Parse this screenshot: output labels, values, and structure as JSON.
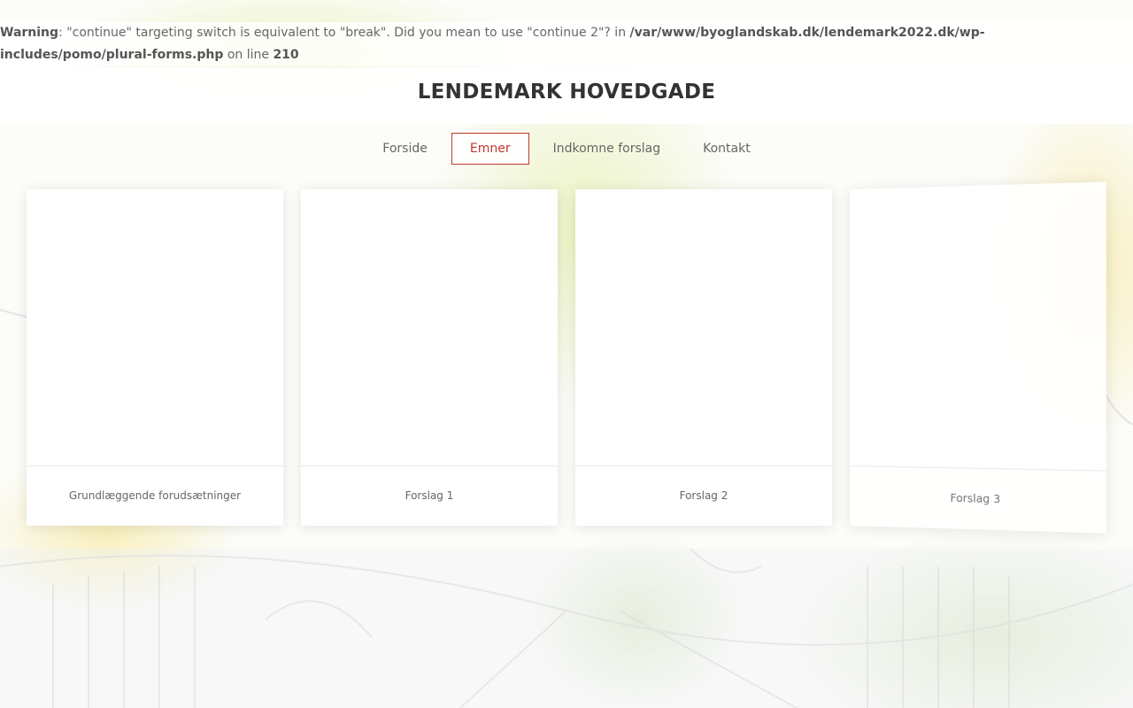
{
  "warning": {
    "label": "Warning",
    "message": ": \"continue\" targeting switch is equivalent to \"break\". Did you mean to use \"continue 2\"? in ",
    "path": "/var/www/byoglandskab.dk/lendemark2022.dk/wp-includes/pomo/plural-forms.php",
    "on_line": " on line ",
    "line": "210"
  },
  "header": {
    "title": "LENDEMARK HOVEDGADE"
  },
  "nav": {
    "items": [
      {
        "label": "Forside"
      },
      {
        "label": "Emner"
      },
      {
        "label": "Indkomne forslag"
      },
      {
        "label": "Kontakt"
      }
    ],
    "active": "Emner"
  },
  "cards": [
    {
      "label": "Grundlæggende forudsætninger"
    },
    {
      "label": "Forslag 1"
    },
    {
      "label": "Forslag 2"
    },
    {
      "label": "Forslag 3"
    }
  ],
  "colors": {
    "accent": "#c0392b",
    "text": "#666666",
    "title": "#333333"
  }
}
